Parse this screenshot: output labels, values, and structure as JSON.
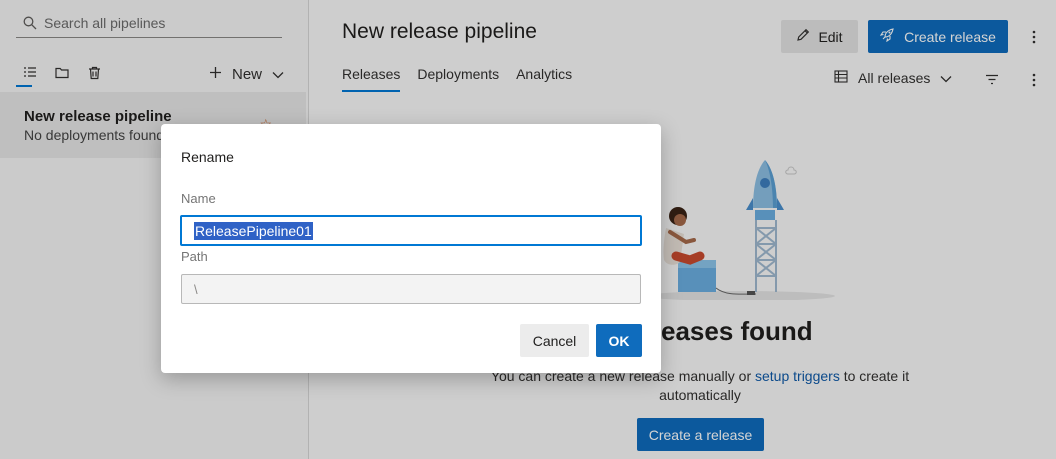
{
  "sidebar": {
    "search_placeholder": "Search all pipelines",
    "new_label": "New",
    "pipelines": [
      {
        "name": "New release pipeline",
        "status": "No deployments found"
      }
    ]
  },
  "header": {
    "title": "New release pipeline",
    "edit_label": "Edit",
    "create_release_label": "Create release"
  },
  "tabs": [
    {
      "label": "Releases",
      "active": true
    },
    {
      "label": "Deployments",
      "active": false
    },
    {
      "label": "Analytics",
      "active": false
    }
  ],
  "toolbar": {
    "view_label": "All releases"
  },
  "empty_state": {
    "title": "No releases found",
    "text_prefix": "You can create a new release manually or",
    "link_text": "setup triggers",
    "text_suffix": "to create it automatically",
    "button_label": "Create a release"
  },
  "dialog": {
    "title": "Rename",
    "name_label": "Name",
    "name_value": "ReleasePipeline01",
    "path_label": "Path",
    "path_value": "\\",
    "cancel_label": "Cancel",
    "ok_label": "OK"
  },
  "colors": {
    "accent": "#0f6cbd",
    "focus_border": "#0078d4",
    "selection": "#2f62c6"
  }
}
